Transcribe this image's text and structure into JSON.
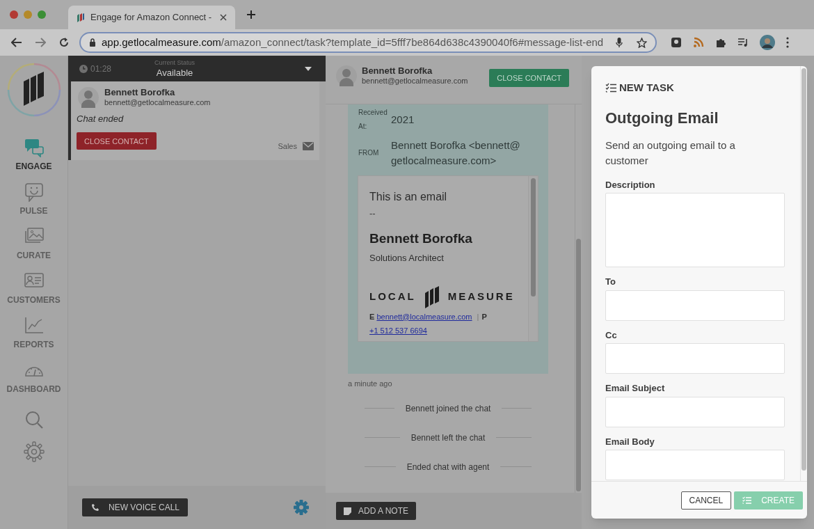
{
  "browser": {
    "tab_title": "Engage for Amazon Connect -",
    "url_host": "app.getlocalmeasure.com",
    "url_path": "/amazon_connect/task?template_id=5fff7be864d638c4390040f6#message-list-end"
  },
  "nav": {
    "items": [
      {
        "kind": "chat",
        "label": "ENGAGE",
        "selected": true
      },
      {
        "kind": "smile",
        "label": "PULSE",
        "selected": false
      },
      {
        "kind": "image",
        "label": "CURATE",
        "selected": false
      },
      {
        "kind": "card",
        "label": "CUSTOMERS",
        "selected": false
      },
      {
        "kind": "chart",
        "label": "REPORTS",
        "selected": false
      },
      {
        "kind": "gauge",
        "label": "DASHBOARD",
        "selected": false
      },
      {
        "kind": "search",
        "selected": false
      },
      {
        "kind": "settings",
        "selected": false
      }
    ]
  },
  "agent_bar": {
    "timer": "01:28",
    "status_label": "Current Status",
    "status": "Available"
  },
  "contacts": [
    {
      "name": "Bennett Borofka",
      "email": "bennett@getlocalmeasure.com",
      "message": "Chat ended",
      "button": "CLOSE CONTACT",
      "queue": "Sales",
      "selected": true
    }
  ],
  "contacts_footer": {
    "button": "NEW VOICE CALL"
  },
  "conversation": {
    "name": "Bennett Borofka",
    "email": "bennett@getlocalmeasure.com",
    "close_button": "CLOSE CONTACT",
    "email_message": {
      "fields": [
        {
          "label": "Received At:",
          "value": "2021"
        },
        {
          "label": "FROM",
          "value": "Bennett Borofka <bennett@getlocalmeasure.com>"
        }
      ],
      "body": {
        "greeting": "This is an email",
        "separator": "--",
        "signature_name": "Bennett Borofka",
        "signature_title": "Solutions Architect",
        "logo_left": "LOCAL",
        "logo_right": "MEASURE",
        "email_label": "E",
        "email_link": "bennett@localmeasure.com",
        "divider": "|",
        "phone_label": "P",
        "phone_link": "+1 512 537 6694"
      }
    },
    "time": "a minute ago",
    "events": [
      "Bennett joined the chat",
      "Bennett left the chat",
      "Ended chat with agent"
    ],
    "note_button": "ADD A NOTE"
  },
  "modal": {
    "kicker": "NEW TASK",
    "title": "Outgoing Email",
    "description": "Send an outgoing email to a customer",
    "fields": [
      {
        "label": "Description",
        "kind": "textarea"
      },
      {
        "label": "To",
        "kind": "input"
      },
      {
        "label": "Cc",
        "kind": "input"
      },
      {
        "label": "Email Subject",
        "kind": "input"
      },
      {
        "label": "Email Body",
        "kind": "input"
      }
    ],
    "buttons": [
      {
        "label": "CANCEL",
        "kind": "secondary",
        "disabled": false
      },
      {
        "label": "CREATE",
        "kind": "primary",
        "disabled": true
      }
    ]
  }
}
